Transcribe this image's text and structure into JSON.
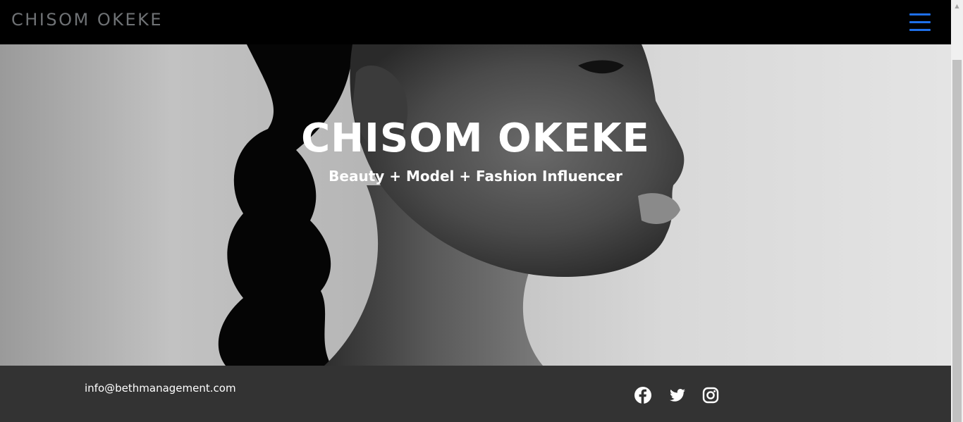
{
  "navbar": {
    "brand": "CHISOM OKEKE",
    "menu_icon": "hamburger-menu-icon",
    "menu_color": "#1e6fe8"
  },
  "hero": {
    "title": "CHISOM OKEKE",
    "subtitle": "Beauty + Model + Fashion Influencer"
  },
  "footer": {
    "email": "info@bethmanagement.com",
    "social": [
      {
        "icon": "facebook-icon"
      },
      {
        "icon": "twitter-icon"
      },
      {
        "icon": "instagram-icon"
      }
    ]
  },
  "colors": {
    "navbar_bg": "#000000",
    "footer_bg": "#333333",
    "brand_text": "#6f7275",
    "hero_text": "#ffffff"
  }
}
